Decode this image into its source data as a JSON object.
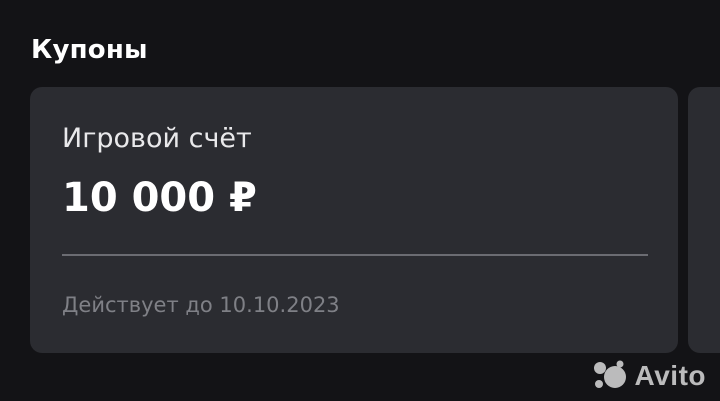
{
  "section": {
    "title": "Купоны"
  },
  "coupons": [
    {
      "type": "Игровой счёт",
      "amount": "10 000 ₽",
      "validity": "Действует до 10.10.2023"
    }
  ],
  "watermark": {
    "text": "Avito",
    "icon": "avito-logo-icon"
  },
  "colors": {
    "background": "#131316",
    "card": "#2b2c31",
    "divider": "#6b6c72",
    "muted_text": "#7f8086"
  }
}
